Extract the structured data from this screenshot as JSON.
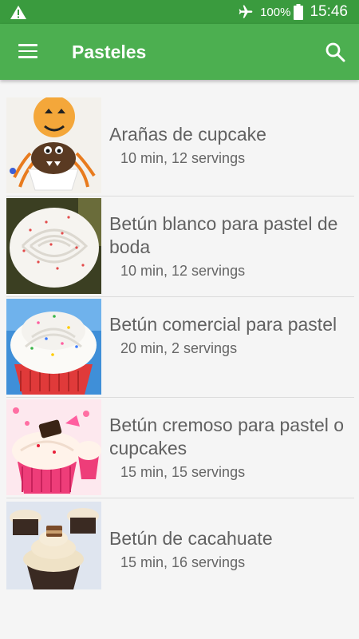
{
  "status_bar": {
    "battery_percent": "100%",
    "time": "15:46",
    "icons": [
      "warning-icon",
      "airplane-mode-icon",
      "battery-icon"
    ]
  },
  "app_bar": {
    "title": "Pasteles",
    "icons": [
      "menu-icon",
      "search-icon"
    ]
  },
  "recipes": [
    {
      "title": "Arañas de cupcake",
      "meta": "10 min, 12 servings"
    },
    {
      "title": "Betún blanco para pastel de boda",
      "meta": "10 min, 12 servings"
    },
    {
      "title": "Betún comercial para pastel",
      "meta": "20 min, 2 servings"
    },
    {
      "title": "Betún cremoso para pastel o cupcakes",
      "meta": "15 min, 15 servings"
    },
    {
      "title": "Betún de cacahuate",
      "meta": "15 min, 16 servings"
    }
  ],
  "colors": {
    "status_bar": "#3a9b3e",
    "app_bar": "#4caf50",
    "background": "#f5f5f5"
  }
}
